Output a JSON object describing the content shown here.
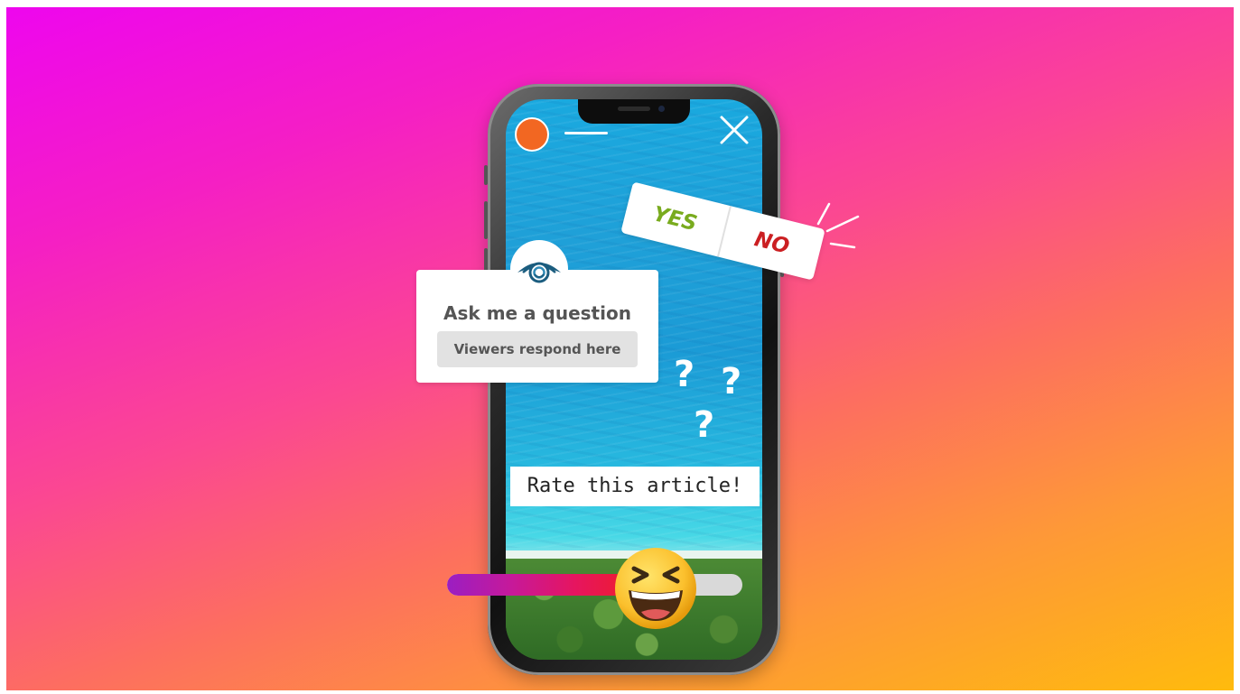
{
  "story": {
    "close_icon": "close-icon"
  },
  "question_sticker": {
    "title": "Ask me a question",
    "placeholder": "Viewers respond here",
    "icon": "eye-icon"
  },
  "poll_sticker": {
    "yes_label": "YES",
    "no_label": "NO"
  },
  "rating_sticker": {
    "label": "Rate this article!",
    "slider_value": 0.62,
    "emoji": "grinning-squinting-face"
  },
  "colors": {
    "background_start": "#ee06ee",
    "background_end": "#ffbb0d",
    "avatar": "#f26722",
    "yes": "#79ab1e",
    "no": "#cb1f22"
  }
}
